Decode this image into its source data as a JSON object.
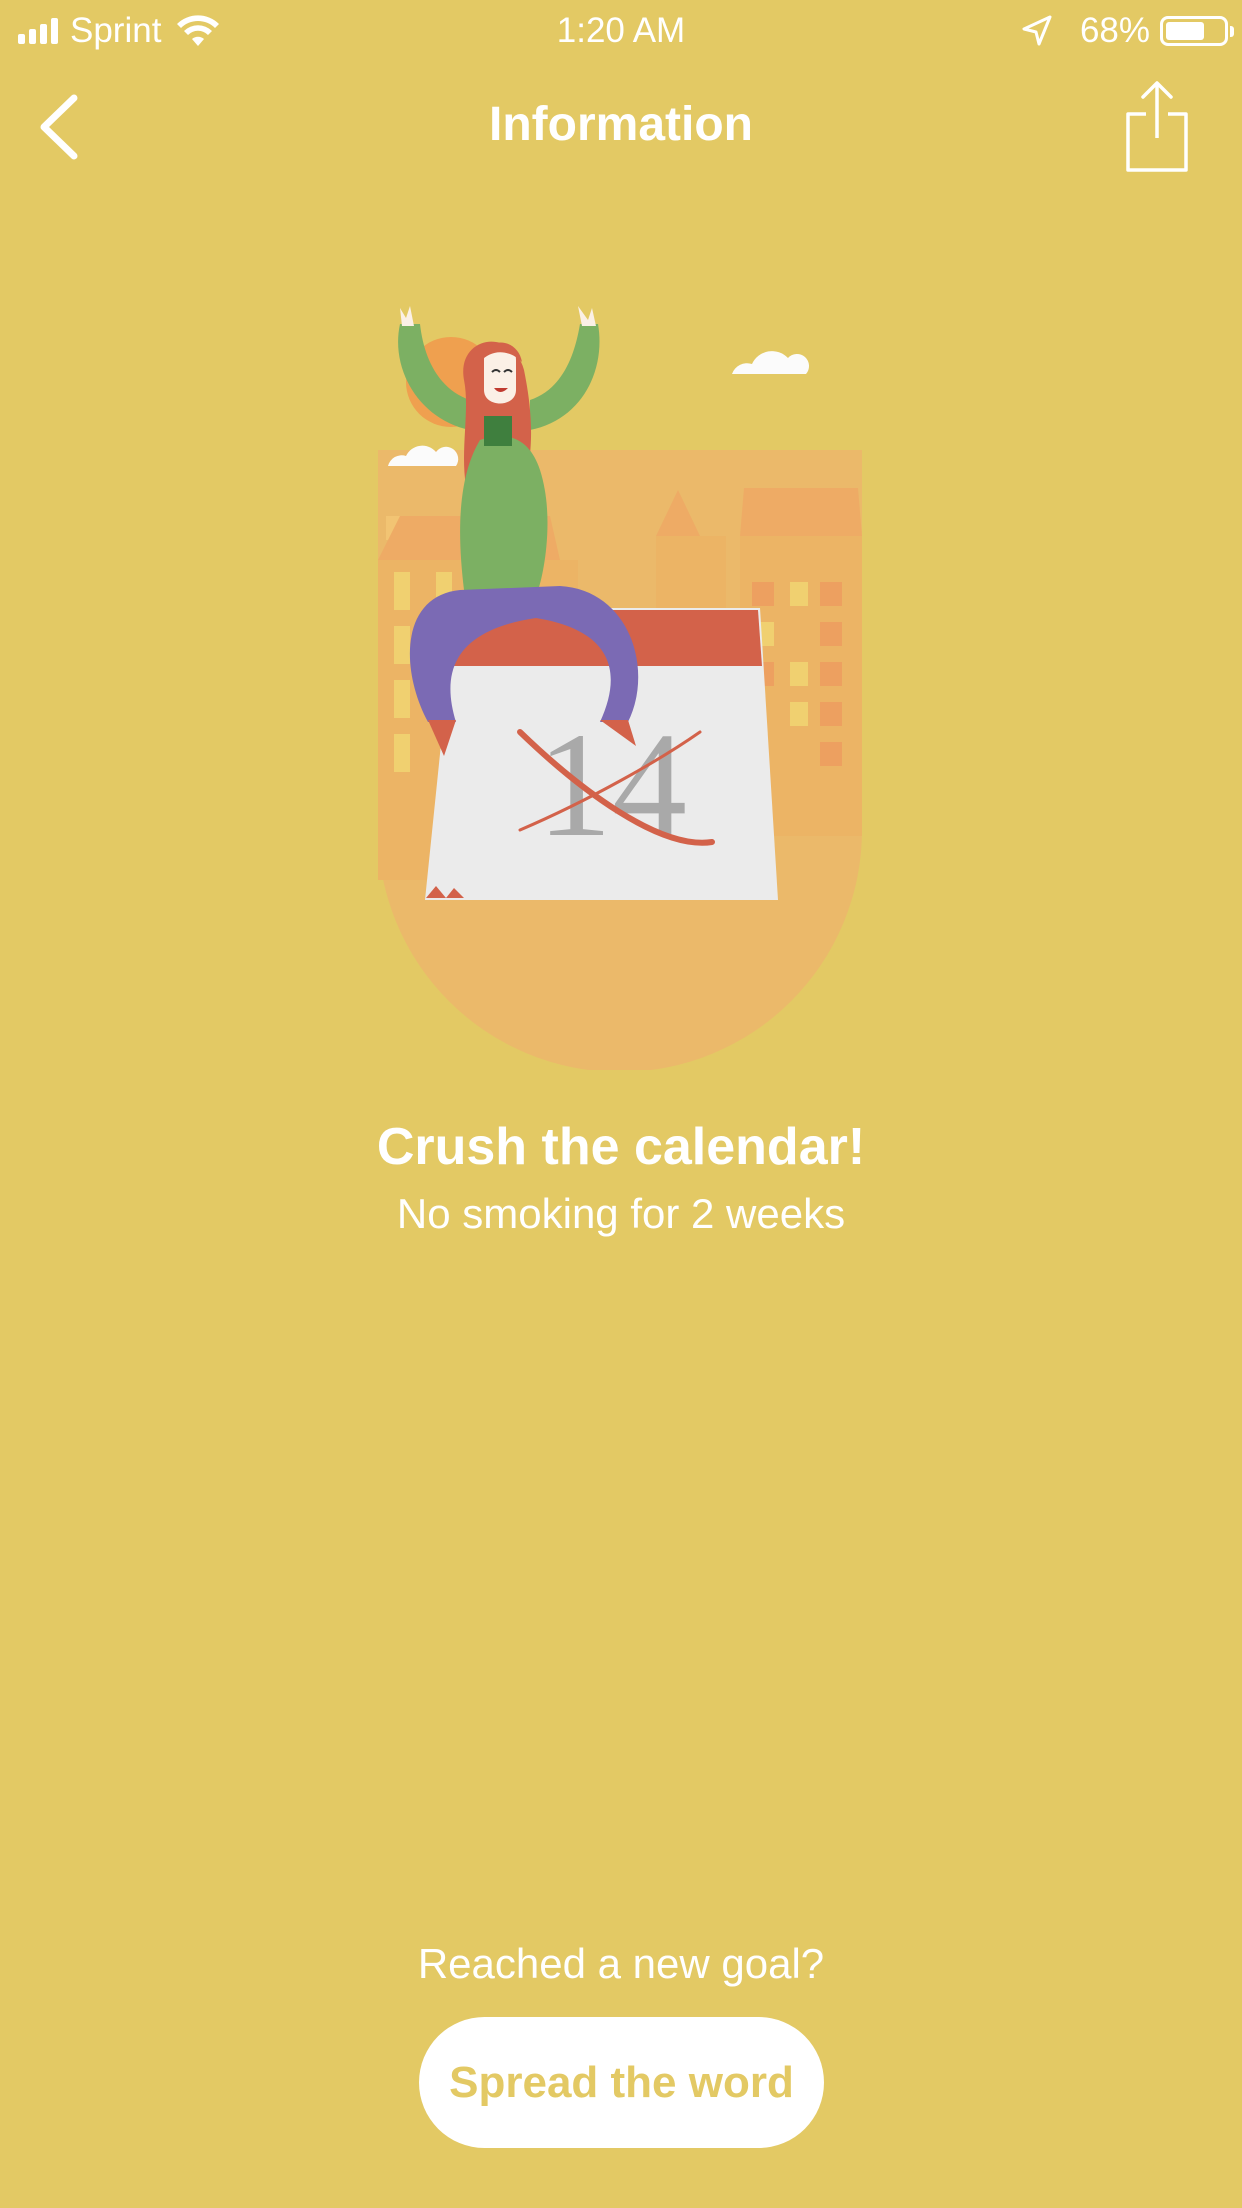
{
  "status_bar": {
    "carrier": "Sprint",
    "time": "1:20 AM",
    "battery_percent": "68%",
    "battery_level": 0.68,
    "signal_bars": 4
  },
  "nav": {
    "title": "Information",
    "back_icon": "chevron-left-icon",
    "share_icon": "share-icon"
  },
  "illustration": {
    "calendar_day": "14",
    "description_icon": "celebration-calendar-illustration"
  },
  "content": {
    "headline": "Crush the calendar!",
    "subline": "No smoking for 2 weeks"
  },
  "footer": {
    "prompt": "Reached a new goal?",
    "button_label": "Spread the word"
  },
  "colors": {
    "background": "#e3c964",
    "button_bg": "#ffffff",
    "button_text": "#e3c964",
    "accent_orange": "#efa04f",
    "calendar_red": "#d3624a",
    "shirt_green": "#7cb063",
    "pants_purple": "#7b6ab4"
  }
}
